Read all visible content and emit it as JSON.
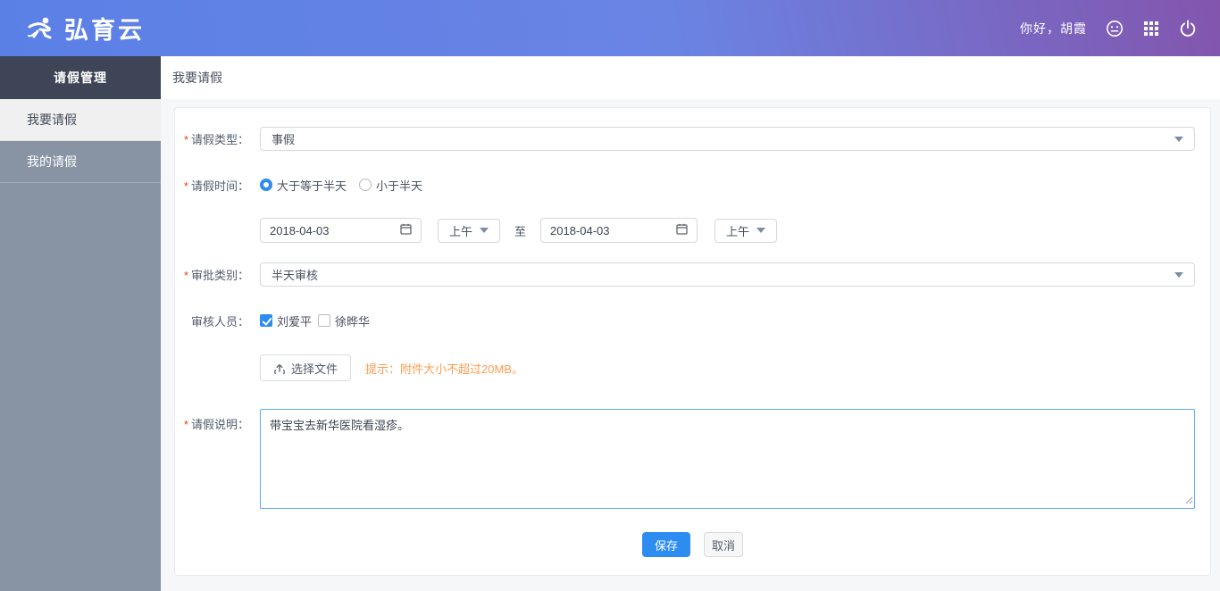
{
  "header": {
    "logo_text": "弘育云",
    "greeting": "你好，胡霞"
  },
  "sidebar": {
    "title": "请假管理",
    "items": [
      {
        "label": "我要请假",
        "active": true
      },
      {
        "label": "我的请假",
        "active": false
      }
    ]
  },
  "breadcrumb": "我要请假",
  "form": {
    "leave_type": {
      "label": "请假类型：",
      "value": "事假"
    },
    "leave_time": {
      "label": "请假时间：",
      "options": [
        {
          "label": "大于等于半天",
          "checked": true
        },
        {
          "label": "小于半天",
          "checked": false
        }
      ]
    },
    "date_range": {
      "start_date": "2018-04-03",
      "start_period": "上午",
      "separator": "至",
      "end_date": "2018-04-03",
      "end_period": "上午"
    },
    "approval_type": {
      "label": "审批类别：",
      "value": "半天审核"
    },
    "reviewers": {
      "label": "审核人员：",
      "options": [
        {
          "label": "刘爱平",
          "checked": true
        },
        {
          "label": "徐晔华",
          "checked": false
        }
      ]
    },
    "attachment": {
      "button_label": "选择文件",
      "hint": "提示：附件大小不超过20MB。"
    },
    "description": {
      "label": "请假说明：",
      "value": "带宝宝去新华医院看湿疹。"
    },
    "buttons": {
      "save": "保存",
      "cancel": "取消"
    }
  },
  "colors": {
    "accent_blue": "#2d8cf0",
    "header_gradient_start": "#5a80e6",
    "header_gradient_end": "#8355ad",
    "sidebar_gray": "#8893a4",
    "sidebar_dark": "#3d4556",
    "hint_orange": "#ff9c50",
    "required_red": "#ed4014",
    "textarea_focus_border": "#5cadf9"
  }
}
